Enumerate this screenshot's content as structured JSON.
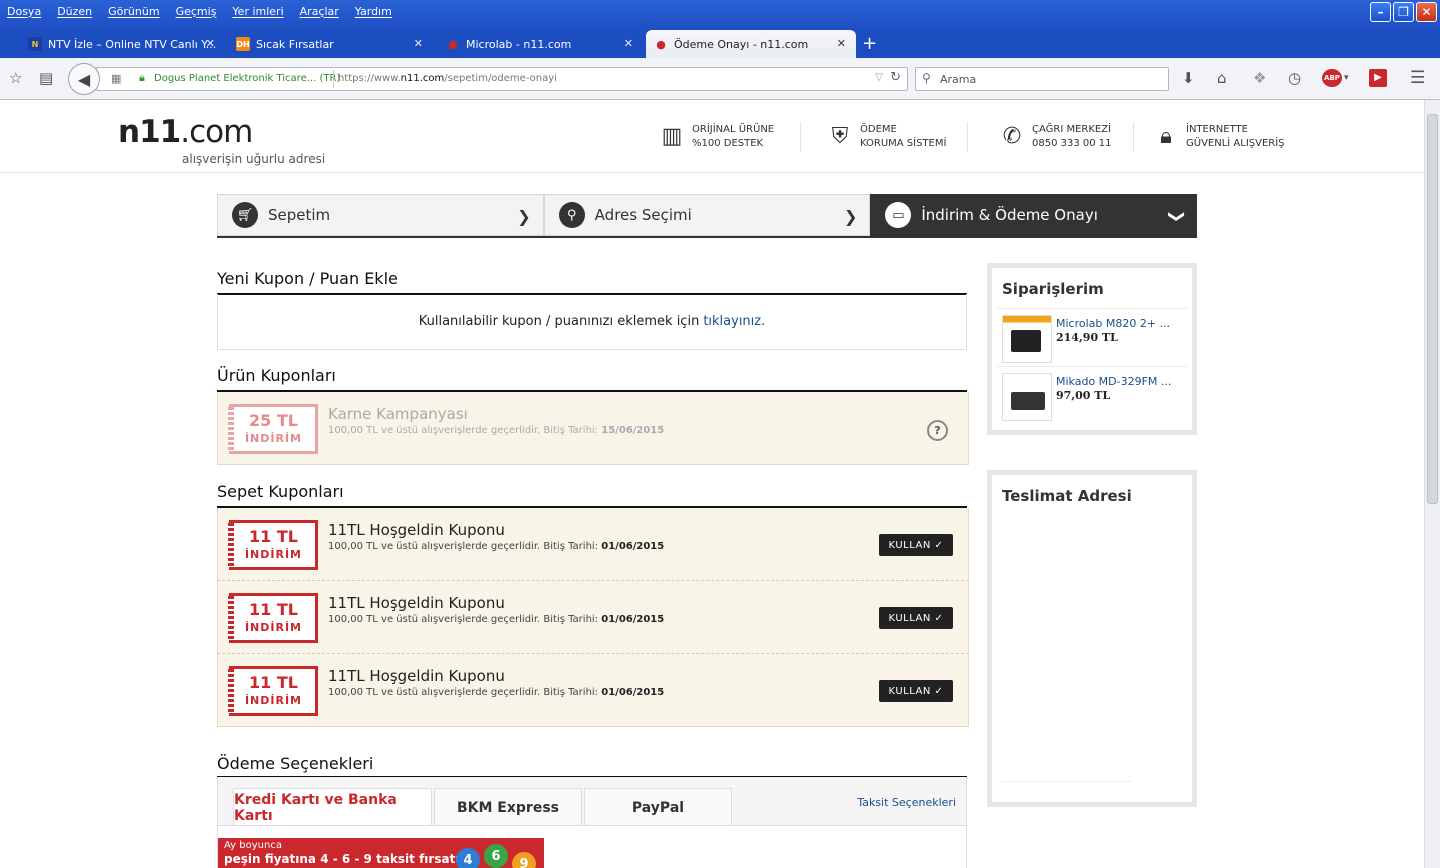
{
  "browser": {
    "menu": [
      "Dosya",
      "Düzen",
      "Görünüm",
      "Geçmiş",
      "Yer imleri",
      "Araçlar",
      "Yardım"
    ],
    "tabs": [
      {
        "title": "NTV İzle – Online NTV Canlı Y...",
        "favicon": "N"
      },
      {
        "title": "Sıcak Fırsatlar",
        "favicon": "DH"
      },
      {
        "title": "Microlab - n11.com",
        "favicon": "n11-ladybug"
      },
      {
        "title": "Ödeme Onayı - n11.com",
        "favicon": "n11-ladybug"
      }
    ],
    "identity": "Dogus Planet Elektronik Ticare... (TR)",
    "url_prefix": "https://www.",
    "url_domain": "n11.com",
    "url_path": "/sepetim/odeme-onayi",
    "search_placeholder": "Arama",
    "adblock": "ABP"
  },
  "site": {
    "logo_main": "n11",
    "logo_suffix": ".com",
    "tagline": "alışverişin uğurlu adresi",
    "header_items": [
      {
        "l1": "ORİJİNAL ÜRÜNE",
        "l2": "%100 DESTEK",
        "icon": "barcode-icon"
      },
      {
        "l1": "ÖDEME",
        "l2": "KORUMA SİSTEMİ",
        "icon": "shield-icon"
      },
      {
        "l1": "ÇAĞRI MERKEZİ",
        "l2": "0850 333 00 11",
        "icon": "phone-icon"
      },
      {
        "l1": "İNTERNETTE",
        "l2": "GÜVENLİ ALIŞVERİŞ",
        "icon": "lock-icon"
      }
    ]
  },
  "steps": [
    {
      "label": "Sepetim",
      "icon": "cart-icon"
    },
    {
      "label": "Adres Seçimi",
      "icon": "location-icon"
    },
    {
      "label": "İndirim & Ödeme Onayı",
      "icon": "card-icon"
    }
  ],
  "new_coupon": {
    "title": "Yeni Kupon / Puan Ekle",
    "text": "Kullanılabilir kupon / puanınızı eklemek için",
    "link": "tıklayınız."
  },
  "product_coupons": {
    "title": "Ürün Kuponları",
    "items": [
      {
        "amount": "25 TL",
        "badge": "İNDİRİM",
        "name": "Karne Kampanyası",
        "desc": "100,00 TL ve üstü alışverişlerde geçerlidir. Bitiş Tarihi:",
        "date": "15/06/2015",
        "help": "?"
      }
    ]
  },
  "cart_coupons": {
    "title": "Sepet Kuponları",
    "button": "KULLAN",
    "items": [
      {
        "amount": "11 TL",
        "badge": "İNDİRİM",
        "name": "11TL Hoşgeldin Kuponu",
        "desc": "100,00 TL ve üstü alışverişlerde geçerlidir. Bitiş Tarihi:",
        "date": "01/06/2015"
      },
      {
        "amount": "11 TL",
        "badge": "İNDİRİM",
        "name": "11TL Hoşgeldin Kuponu",
        "desc": "100,00 TL ve üstü alışverişlerde geçerlidir. Bitiş Tarihi:",
        "date": "01/06/2015"
      },
      {
        "amount": "11 TL",
        "badge": "İNDİRİM",
        "name": "11TL Hoşgeldin Kuponu",
        "desc": "100,00 TL ve üstü alışverişlerde geçerlidir. Bitiş Tarihi:",
        "date": "01/06/2015"
      }
    ]
  },
  "payment": {
    "title": "Ödeme Seçenekleri",
    "tabs": [
      "Kredi Kartı ve Banka Kartı",
      "BKM Express",
      "PayPal"
    ],
    "taksit_link": "Taksit Seçenekleri",
    "banner_l1": "Ay boyunca",
    "banner_l2": "peşin fiyatına 4 - 6 - 9 taksit fırsatı!",
    "balls": [
      "4",
      "6",
      "9"
    ]
  },
  "sidebar": {
    "orders_title": "Siparişlerim",
    "orders": [
      {
        "name": "Microlab M820 2+ ...",
        "price": "214,90 TL"
      },
      {
        "name": "Mikado MD-329FM ...",
        "price": "97,00 TL"
      }
    ],
    "address_title": "Teslimat Adresi"
  },
  "colors": {
    "brand_red": "#c9282d",
    "dark": "#333333",
    "link": "#1a4d8f",
    "coupon_bg": "#f9f4e8"
  }
}
